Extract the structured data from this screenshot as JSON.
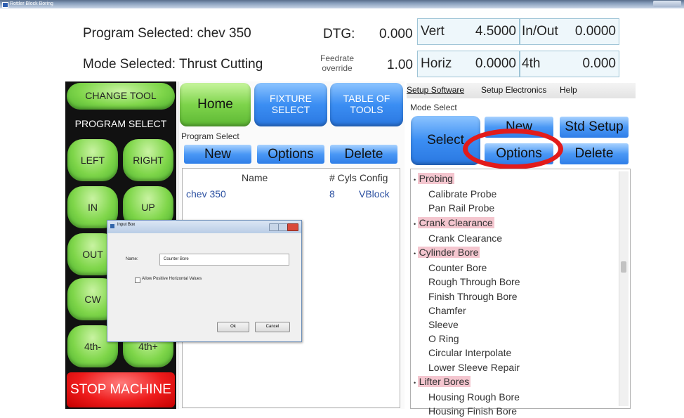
{
  "window": {
    "title": "Rottler Block Boring"
  },
  "status": {
    "program_selected": "Program Selected: chev 350",
    "mode_selected": "Mode Selected: Thrust Cutting",
    "dtg_label": "DTG:",
    "dtg_value": "0.000",
    "feedrate_label_1": "Feedrate",
    "feedrate_label_2": "override",
    "feedrate_value": "1.00",
    "vert_label": "Vert",
    "vert_value": "4.5000",
    "horiz_label": "Horiz",
    "horiz_value": "0.0000",
    "inout_label": "In/Out",
    "inout_value": "0.0000",
    "fourth_label": "4th",
    "fourth_value": "0.000"
  },
  "left_panel": {
    "change_tool": "CHANGE TOOL",
    "program_select": "PROGRAM SELECT",
    "left": "LEFT",
    "right": "RIGHT",
    "in": "IN",
    "up": "UP",
    "out": "OUT",
    "cw": "CW",
    "fourth_minus": "4th-",
    "fourth_plus": "4th+",
    "stop": "STOP MACHINE"
  },
  "middle_panel": {
    "home": "Home",
    "fixture_select_1": "FIXTURE",
    "fixture_select_2": "SELECT",
    "table_of_tools_1": "TABLE OF",
    "table_of_tools_2": "TOOLS",
    "program_select_label": "Program Select",
    "new": "New",
    "options": "Options",
    "delete": "Delete",
    "columns": {
      "name": "Name",
      "cyls": "# Cyls",
      "config": "Config"
    },
    "rows": [
      {
        "name": "chev 350",
        "cyls": "8",
        "config": "VBlock"
      }
    ]
  },
  "dialog": {
    "title": "Input Box",
    "name_label": "Name:",
    "name_value": "Counter Bore",
    "checkbox_label": "Allow Positive Horizontal Values",
    "ok": "Ok",
    "cancel": "Cancel"
  },
  "right_panel": {
    "menu": [
      "Setup Software",
      "Setup Electronics",
      "Help"
    ],
    "mode_select_label": "Mode Select",
    "select": "Select",
    "new": "New",
    "std_setup": "Std Setup",
    "options": "Options",
    "delete": "Delete",
    "tree": [
      {
        "text": "Probing",
        "category": true
      },
      {
        "text": "Calibrate Probe",
        "category": false
      },
      {
        "text": "Pan Rail Probe",
        "category": false
      },
      {
        "text": "Crank Clearance",
        "category": true
      },
      {
        "text": "Crank Clearance",
        "category": false
      },
      {
        "text": "Cylinder Bore",
        "category": true
      },
      {
        "text": "Counter Bore",
        "category": false
      },
      {
        "text": "Rough Through Bore",
        "category": false
      },
      {
        "text": "Finish Through Bore",
        "category": false
      },
      {
        "text": "Chamfer",
        "category": false
      },
      {
        "text": "Sleeve",
        "category": false
      },
      {
        "text": "O Ring",
        "category": false
      },
      {
        "text": "Circular Interpolate",
        "category": false
      },
      {
        "text": "Lower Sleeve Repair",
        "category": false
      },
      {
        "text": "Lifter Bores",
        "category": true
      },
      {
        "text": "Housing Rough Bore",
        "category": false
      },
      {
        "text": "Housing Finish Bore",
        "category": false
      }
    ]
  },
  "colors": {
    "accent_green": "#7ed44b",
    "accent_blue": "#3b8ef3",
    "stop_red": "#ee1c1c",
    "highlight_ring": "#e21b1b",
    "category_bg": "#f4c6cf"
  }
}
